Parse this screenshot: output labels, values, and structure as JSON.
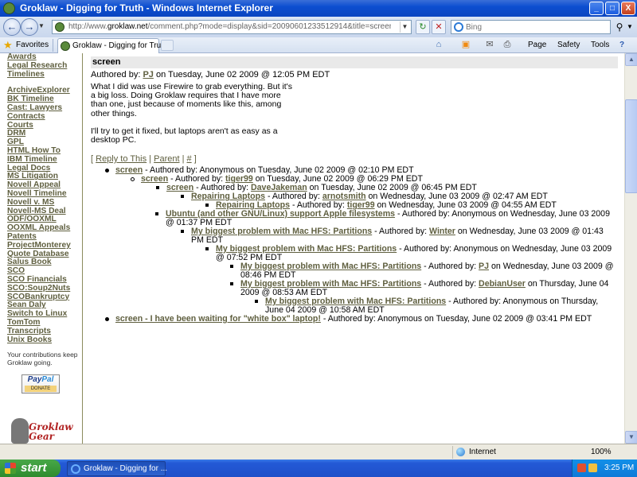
{
  "window": {
    "title": "Groklaw - Digging for Truth - Windows Internet Explorer",
    "min": "_",
    "max": "□",
    "close": "X"
  },
  "address": {
    "url_prefix": "http://www.",
    "url_domain": "groklaw.net",
    "url_rest": "/comment.php?mode=display&sid=20090601233512914&title=screen&type=article&or",
    "search_placeholder": "Bing"
  },
  "favbar": {
    "favorites_label": "Favorites",
    "tab_label": "Groklaw - Digging for Truth",
    "page_label": "Page",
    "safety_label": "Safety",
    "tools_label": "Tools",
    "help_label": "?"
  },
  "sidebar": {
    "links": [
      "Awards",
      "Legal Research",
      "Timelines"
    ],
    "links2": [
      "ArchiveExplorer",
      "BK Timeline",
      "Cast: Lawyers",
      "Contracts",
      "Courts",
      "DRM",
      "GPL",
      "HTML How To",
      "IBM Timeline",
      "Legal Docs",
      "MS Litigation",
      "Novell Appeal",
      "Novell Timeline",
      "Novell v. MS",
      "Novell-MS Deal",
      "ODF/OOXML",
      "OOXML Appeals",
      "Patents",
      "ProjectMonterey",
      "Quote Database",
      "Salus Book",
      "SCO",
      "SCO Financials",
      "SCO:Soup2Nuts",
      "SCOBankruptcy",
      "Sean Daly",
      "Switch to Linux",
      "TomTom",
      "Transcripts",
      "Unix Books"
    ],
    "note": "Your contributions keep Groklaw going.",
    "paypal_pay": "Pay",
    "paypal_pal": "Pal",
    "paypal_donate": "DONATE",
    "logo_text": "Groklaw Gear"
  },
  "comment": {
    "header": "screen",
    "byline_prefix": "Authored by: ",
    "author": "PJ",
    "byline_suffix": " on Tuesday, June 02 2009 @ 12:05 PM EDT",
    "para1": "What I did was use Firewire to grab everything. But it's a big loss. Doing Groklaw requires that I have more than one, just because of moments like this, among other things.",
    "para2": "I'll try to get it fixed, but laptops aren't as easy as a desktop PC.",
    "reply_open": "[ ",
    "reply": "Reply to This",
    "sep": " | ",
    "parent": "Parent",
    "hash": "#",
    "reply_close": " ]"
  },
  "thread": [
    {
      "title": "screen",
      "author": "Anonymous",
      "author_link": false,
      "date": "Tuesday, June 02 2009 @ 02:10 PM EDT"
    },
    {
      "title": "screen",
      "author": "tiger99",
      "author_link": true,
      "date": "Tuesday, June 02 2009 @ 06:29 PM EDT"
    },
    {
      "title": "screen",
      "author": "DaveJakeman",
      "author_link": true,
      "date": "Tuesday, June 02 2009 @ 06:45 PM EDT"
    },
    {
      "title": "Repairing Laptops",
      "author": "arnotsmith",
      "author_link": true,
      "date": "Wednesday, June 03 2009 @ 02:47 AM EDT"
    },
    {
      "title": "Repairing Laptops",
      "author": "tiger99",
      "author_link": true,
      "date": "Wednesday, June 03 2009 @ 04:55 AM EDT"
    },
    {
      "title": "Ubuntu (and other GNU/Linux) support Apple filesystems",
      "author": "Anonymous",
      "author_link": false,
      "date": "Wednesday, June 03 2009 @ 01:37 PM EDT"
    },
    {
      "title": "My biggest problem with Mac HFS: Partitions",
      "author": "Winter",
      "author_link": true,
      "date": "Wednesday, June 03 2009 @ 01:43 PM EDT"
    },
    {
      "title": "My biggest problem with Mac HFS: Partitions",
      "author": "Anonymous",
      "author_link": false,
      "date": "Wednesday, June 03 2009 @ 07:52 PM EDT"
    },
    {
      "title": "My biggest problem with Mac HFS: Partitions",
      "author": "PJ",
      "author_link": true,
      "date": "Wednesday, June 03 2009 @ 08:46 PM EDT"
    },
    {
      "title": "My biggest problem with Mac HFS: Partitions",
      "author": "DebianUser",
      "author_link": true,
      "date": "Thursday, June 04 2009 @ 08:53 AM EDT"
    },
    {
      "title": "My biggest problem with Mac HFS: Partitions",
      "author": "Anonymous",
      "author_link": false,
      "date": "Thursday, June 04 2009 @ 10:58 AM EDT"
    },
    {
      "title": "screen - I have been waiting for \"white box\" laptop!",
      "author": "Anonymous",
      "author_link": false,
      "date": "Tuesday, June 02 2009 @ 03:41 PM EDT"
    }
  ],
  "thread_authored_by": " - Authored by: ",
  "thread_on": " on ",
  "status": {
    "zone": "Internet",
    "zoom": "100%"
  },
  "taskbar": {
    "start": "start",
    "task": "Groklaw - Digging for ...",
    "clock": "3:25 PM"
  },
  "colors": {
    "link": "#5f5f3f",
    "titlebar": "#0c4ed0",
    "taskbar": "#2359d6"
  },
  "icons": [
    "back-icon",
    "forward-icon",
    "refresh-icon",
    "stop-icon",
    "search-icon",
    "favorites-star-icon",
    "home-icon",
    "rss-icon",
    "mail-icon",
    "print-icon",
    "globe-icon",
    "windows-flag-icon"
  ]
}
